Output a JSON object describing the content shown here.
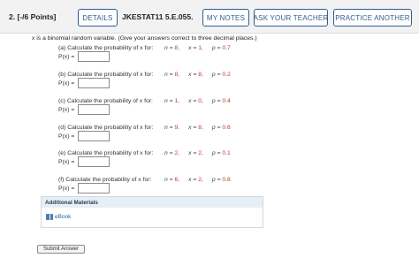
{
  "header": {
    "question_number": "2.",
    "points": "[-/6 Points]",
    "details_label": "DETAILS",
    "question_id": "JKESTAT11 5.E.055.",
    "my_notes_label": "MY NOTES",
    "ask_teacher_label": "ASK YOUR TEACHER",
    "practice_label": "PRACTICE ANOTHER"
  },
  "question": {
    "intro": "x is a binomial random variable. (Give your answers correct to three decimal places.)",
    "answer_label": "P(x) =",
    "parts": [
      {
        "prompt": "(a) Calculate the probability of x for:",
        "n": "8,",
        "x": "1,",
        "p": "0.7"
      },
      {
        "prompt": "(b) Calculate the probability of x for:",
        "n": "8,",
        "x": "8,",
        "p": "0.2"
      },
      {
        "prompt": "(c) Calculate the probability of x for:",
        "n": "1,",
        "x": "0,",
        "p": "0.4"
      },
      {
        "prompt": "(d) Calculate the probability of x for:",
        "n": "9,",
        "x": "8,",
        "p": "0.6"
      },
      {
        "prompt": "(e) Calculate the probability of x for:",
        "n": "2,",
        "x": "2,",
        "p": "0.1"
      },
      {
        "prompt": "(f) Calculate the probability of x for:",
        "n": "6,",
        "x": "2,",
        "p": "0.8"
      }
    ],
    "param_labels": {
      "n": "n =",
      "x": "x =",
      "p": "p ="
    }
  },
  "additional_materials": {
    "title": "Additional Materials",
    "ebook_label": "eBook"
  },
  "submit_label": "Submit Answer"
}
